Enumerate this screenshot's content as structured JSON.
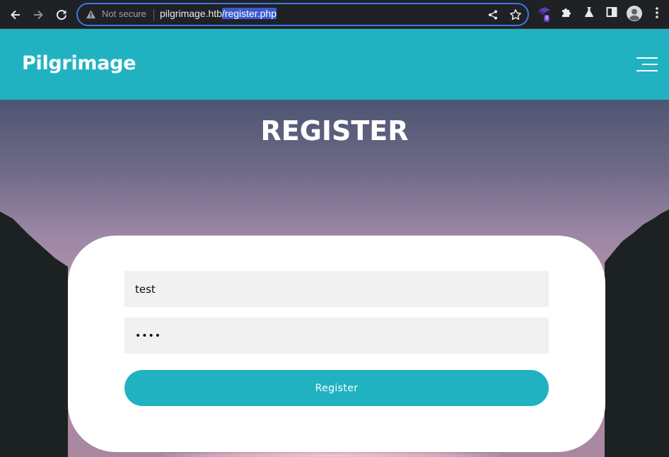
{
  "browser": {
    "security_label": "Not secure",
    "url_host": "pilgrimage.htb",
    "url_path": "/register.php",
    "extension_badge": "8",
    "icons": [
      "back-arrow-icon",
      "forward-arrow-icon",
      "reload-icon",
      "warning-icon",
      "share-icon",
      "star-icon",
      "extension-icon",
      "puzzle-icon",
      "labs-flask-icon",
      "side-panel-icon",
      "profile-icon",
      "kebab-menu-icon"
    ]
  },
  "site": {
    "brand": "Pilgrimage",
    "menu_icon": "hamburger-menu-icon",
    "accent_color": "#21b2c1"
  },
  "page": {
    "title": "REGISTER"
  },
  "form": {
    "username_value": "test",
    "password_value": "test",
    "submit_label": "Register"
  }
}
